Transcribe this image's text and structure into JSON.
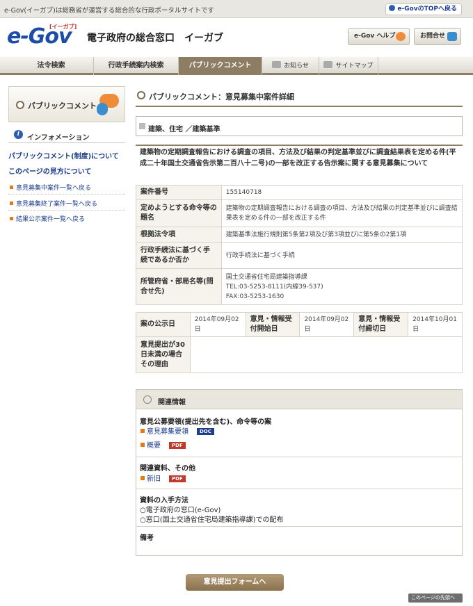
{
  "topbar": {
    "tagline": "e-Gov(イーガブ)は総務省が運営する総合的な行政ポータルサイトです",
    "top_link": "e-GovのTOPへ戻る"
  },
  "header": {
    "logo_text": "e-Gov",
    "logo_kana": "[イーガブ]",
    "site_title": "電子政府の総合窓口　イーガブ",
    "help_button": "e-Gov ヘルプ",
    "contact_button": "お問合せ"
  },
  "nav": {
    "tabs": [
      {
        "label": "法令検索"
      },
      {
        "label": "行政手続案内検索"
      },
      {
        "label": "パブリックコメント"
      },
      {
        "label": "お知らせ"
      },
      {
        "label": "サイトマップ"
      }
    ]
  },
  "sidebar": {
    "heading": "パブリックコメント",
    "info_heading": "インフォメーション",
    "links": [
      "パブリックコメント(制度)について",
      "このページの見方について",
      "意見募集中案件一覧へ戻る",
      "意見募集終了案件一覧へ戻る",
      "結果公示案件一覧へ戻る"
    ]
  },
  "main": {
    "page_title": "パブリックコメント：意見募集中案件詳細",
    "category": "建築、住宅 ／建築基準",
    "subject": "建築物の定期調査報告における調査の項目、方法及び結果の判定基準並びに調査結果表を定める件(平成二十年国土交通省告示第二百八十二号)の一部を改正する告示案に関する意見募集について",
    "details": {
      "case_no_label": "案件番号",
      "case_no": "155140718",
      "title_label": "定めようとする命令等の題名",
      "title": "建築物の定期調査報告における調査の項目、方法及び結果の判定基準並びに調査結果表を定める件の一部を改正する件",
      "basis_label": "根拠法令項",
      "basis": "建築基準法施行規則第5条第2項及び第3項並びに第5条の2第1項",
      "procedure_label": "行政手続法に基づく手続であるか否か",
      "procedure": "行政手続法に基づく手続",
      "ministry_label": "所管府省・部局名等(問合せ先)",
      "ministry": "国土交通省住宅局建築指導課",
      "tel": "TEL:03-5253-8111(内線39-537)",
      "fax": "FAX:03-5253-1630"
    },
    "dates": {
      "announce_label": "案の公示日",
      "announce_date": "2014年09月02日",
      "start_label": "意見・情報受付開始日",
      "start_date": "2014年09月02日",
      "end_label": "意見・情報受付締切日",
      "end_date": "2014年10月01日",
      "reason_label": "意見提出が30日未満の場合その理由",
      "reason": ""
    },
    "related": {
      "heading": "関連情報",
      "sec1_title": "意見公募要領(提出先を含む)、命令等の案",
      "sec1_links": [
        {
          "label": "意見募集要領",
          "badge": "DOC"
        },
        {
          "label": "概要",
          "badge": "PDF"
        }
      ],
      "sec2_title": "関連資料、その他",
      "sec2_links": [
        {
          "label": "新旧",
          "badge": "PDF"
        }
      ],
      "sec3_title": "資料の入手方法",
      "sec3_lines": [
        "○電子政府の窓口(e-Gov)",
        "○窓口(国土交通省住宅局建築指導課)での配布"
      ],
      "sec4_title": "備考"
    },
    "submit_button": "意見提出フォームへ",
    "page_top": "このページの先頭へ"
  },
  "colors": {
    "accent": "#8d7d64",
    "link": "#1a3a8a",
    "pdf": "#c0392b",
    "doc": "#1e3d8a"
  }
}
